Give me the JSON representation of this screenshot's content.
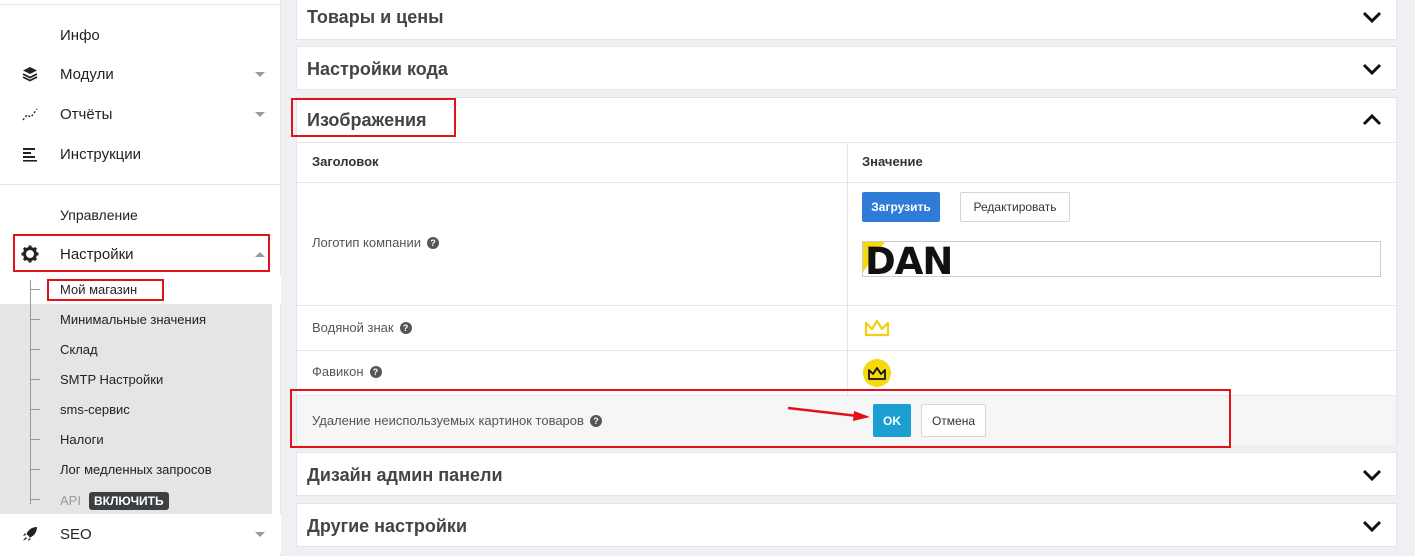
{
  "sidebar": {
    "info": "Инфо",
    "modules": "Модули",
    "reports": "Отчёты",
    "instructions": "Инструкции",
    "section_manage": "Управление",
    "settings": "Настройки",
    "submenu": [
      "Мой магазин",
      "Минимальные значения",
      "Склад",
      "SMTP Настройки",
      "sms-сервис",
      "Налоги",
      "Лог медленных запросов",
      "API"
    ],
    "api_badge": "ВКЛЮЧИТЬ",
    "seo": "SEO"
  },
  "panels": {
    "goods": "Товары и цены",
    "code": "Настройки кода",
    "images": "Изображения",
    "design": "Дизайн админ панели",
    "other": "Другие настройки"
  },
  "images_table": {
    "col_title": "Заголовок",
    "col_value": "Значение",
    "logo_label": "Логотип компании",
    "upload_btn": "Загрузить",
    "edit_btn": "Редактировать",
    "logo_text": "DAN",
    "watermark_label": "Водяной знак",
    "favicon_label": "Фавикон",
    "delete_label": "Удаление неиспользуемых картинок товаров",
    "ok_btn": "OK",
    "cancel_btn": "Отмена",
    "help_glyph": "?"
  },
  "colors": {
    "accent": "#2f7bd8",
    "ok": "#1a9fd0",
    "highlight": "#e0131a",
    "logo_yellow": "#f5d90a"
  }
}
